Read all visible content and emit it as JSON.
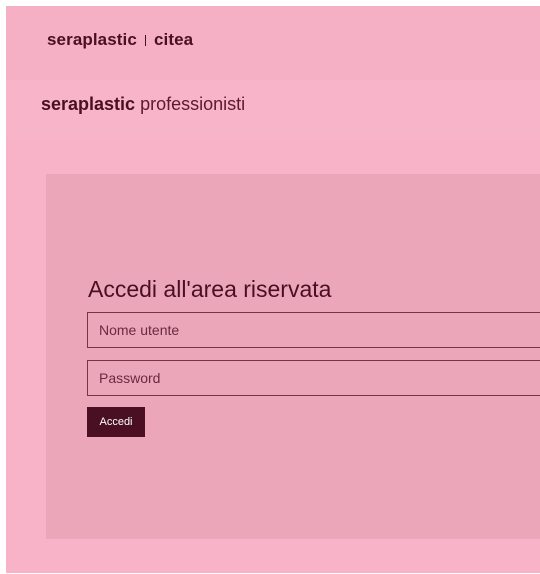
{
  "header": {
    "brand_primary": "seraplastic",
    "brand_secondary": "citea"
  },
  "subheader": {
    "brand_strong": "seraplastic",
    "brand_light": "professionisti"
  },
  "login": {
    "title": "Accedi all'area riservata",
    "username_placeholder": "Nome utente",
    "password_placeholder": "Password",
    "submit_label": "Accedi"
  },
  "colors": {
    "background": "#f8b3c9",
    "panel": "#eca6b9",
    "brand": "#4a0f22"
  }
}
